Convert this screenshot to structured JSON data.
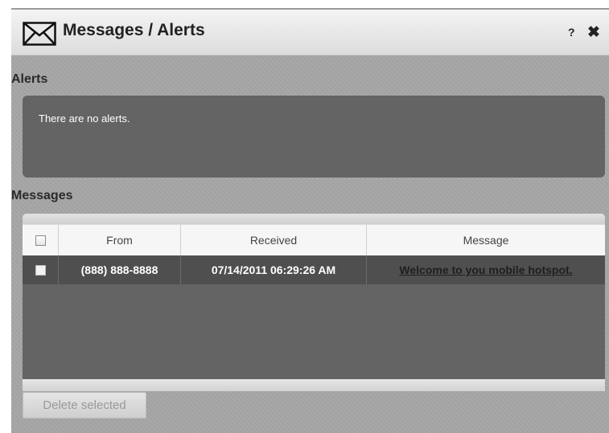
{
  "dialog": {
    "title": "Messages / Alerts",
    "help": "?",
    "close": "✖"
  },
  "alerts": {
    "label": "Alerts",
    "empty_text": "There are no alerts."
  },
  "messages": {
    "label": "Messages",
    "columns": {
      "from": "From",
      "received": "Received",
      "message": "Message"
    },
    "rows": [
      {
        "from": "(888) 888-8888",
        "received": "07/14/2011 06:29:26 AM",
        "message": "Welcome to you mobile hotspot."
      }
    ],
    "delete_label": "Delete selected"
  },
  "icons": {
    "header": "mail-icon",
    "help": "help-icon",
    "close": "close-icon"
  },
  "colors": {
    "panel": "#a6a6a6",
    "dark_box": "#646464",
    "row": "#4f4f4f"
  }
}
